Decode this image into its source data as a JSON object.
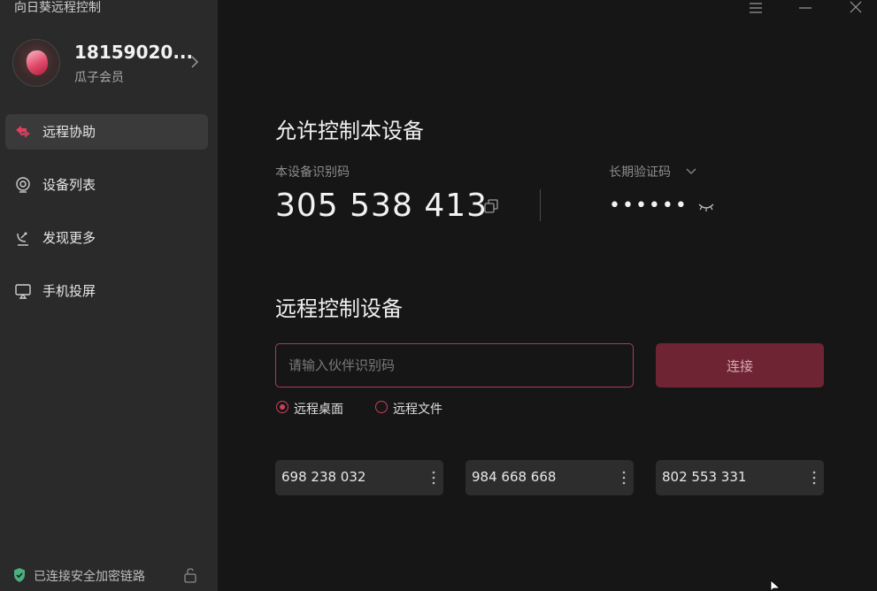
{
  "app": {
    "title": "向日葵远程控制"
  },
  "profile": {
    "name": "18159020...",
    "membership": "瓜子会员"
  },
  "sidebar": {
    "items": [
      {
        "label": "远程协助",
        "icon": "remote-assist-icon",
        "active": true
      },
      {
        "label": "设备列表",
        "icon": "device-list-icon",
        "active": false
      },
      {
        "label": "发现更多",
        "icon": "discover-icon",
        "active": false
      },
      {
        "label": "手机投屏",
        "icon": "screen-cast-icon",
        "active": false
      }
    ],
    "status": "已连接安全加密链路"
  },
  "allow": {
    "title": "允许控制本设备",
    "device_id_label": "本设备识别码",
    "device_id": "305 538 413",
    "password_label": "长期验证码",
    "password_masked": "••••••"
  },
  "remote": {
    "title": "远程控制设备",
    "input_placeholder": "请输入伙伴识别码",
    "connect_label": "连接",
    "modes": [
      {
        "label": "远程桌面",
        "selected": true
      },
      {
        "label": "远程文件",
        "selected": false
      }
    ],
    "recent": [
      "698 238 032",
      "984 668 668",
      "802 553 331"
    ]
  },
  "colors": {
    "accent": "#c9405d",
    "button": "#6e2433",
    "sidebar": "#2a2a2a",
    "main": "#161616"
  }
}
